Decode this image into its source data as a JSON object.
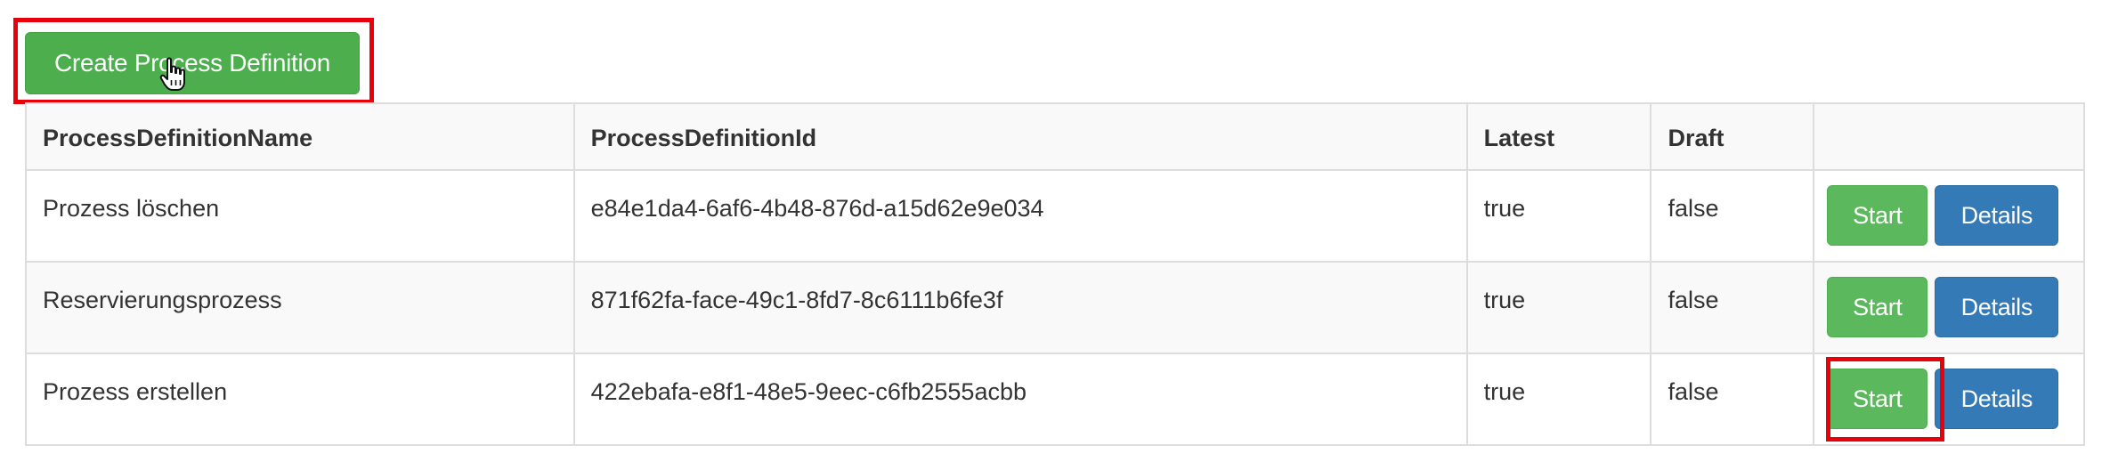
{
  "toolbar": {
    "create_label": "Create Process Definition"
  },
  "table": {
    "headers": [
      "ProcessDefinitionName",
      "ProcessDefinitionId",
      "Latest",
      "Draft",
      ""
    ],
    "rows": [
      {
        "name": "Prozess löschen",
        "id": "e84e1da4-6af6-4b48-876d-a15d62e9e034",
        "latest": "true",
        "draft": "false",
        "start_label": "Start",
        "details_label": "Details"
      },
      {
        "name": "Reservierungsprozess",
        "id": "871f62fa-face-49c1-8fd7-8c6111b6fe3f",
        "latest": "true",
        "draft": "false",
        "start_label": "Start",
        "details_label": "Details"
      },
      {
        "name": "Prozess erstellen",
        "id": "422ebafa-e8f1-48e5-9eec-c6fb2555acbb",
        "latest": "true",
        "draft": "false",
        "start_label": "Start",
        "details_label": "Details"
      }
    ]
  },
  "colors": {
    "create_button": "#4cae4c",
    "start_button": "#5cb85c",
    "details_button": "#337ab7",
    "highlight": "#e8000b"
  },
  "icons": {
    "cursor": "hand-pointer-icon"
  }
}
